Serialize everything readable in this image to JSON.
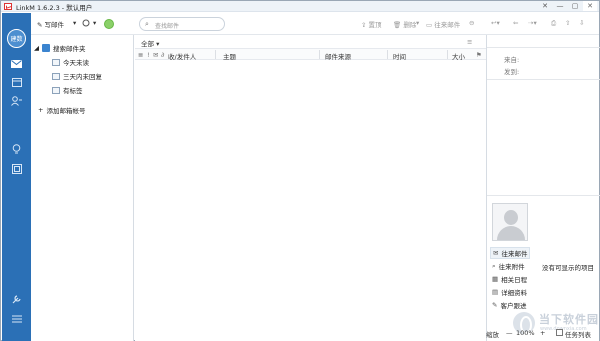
{
  "window": {
    "title": "LinkM 1.6.2.3  -  默认用户",
    "buttons": [
      "✕",
      "—",
      "▢",
      "✕"
    ]
  },
  "sidebar": {
    "avatar_text": "建数",
    "icons": [
      "mail-icon",
      "calendar-icon",
      "contacts-icon",
      "idea-icon",
      "addressbook-icon",
      "settings-icon",
      "menu-icon"
    ]
  },
  "toolbar": {
    "compose": "写邮件",
    "compose_arrow": "▾",
    "refresh_arrow": "▾",
    "search_placeholder": "查找邮件",
    "pin": "置顶",
    "delete": "删除",
    "exchange_mail": "往来邮件",
    "list_icon": "≡"
  },
  "folders": {
    "root": "搜索邮件夹",
    "today": "今天未读",
    "three_days": "三天内未回复",
    "tagged": "有标签",
    "add_account": "添加邮箱帐号"
  },
  "maillist": {
    "filter": "全部",
    "columns": {
      "sender": "收/发件人",
      "subject": "主题",
      "source": "邮件来源",
      "time": "时间",
      "size": "大小"
    }
  },
  "preview": {
    "from_label": "来自:",
    "to_label": "发到:",
    "empty_text": "没有可显示的项目",
    "items": [
      {
        "label": "往来邮件",
        "icon": "✉",
        "active": true
      },
      {
        "label": "往来附件",
        "icon": "⌕"
      },
      {
        "label": "相关日程",
        "icon": "▦"
      },
      {
        "label": "详细资料",
        "icon": "▤"
      },
      {
        "label": "客户跟进",
        "icon": "✎"
      }
    ]
  },
  "statusbar": {
    "zoom_label": "缩放",
    "zoom_minus": "—",
    "zoom_value": "100%",
    "zoom_plus": "+",
    "tasklist": "任务列表"
  },
  "watermark": {
    "big": "当下软件园",
    "small": "www.downxia.com"
  }
}
